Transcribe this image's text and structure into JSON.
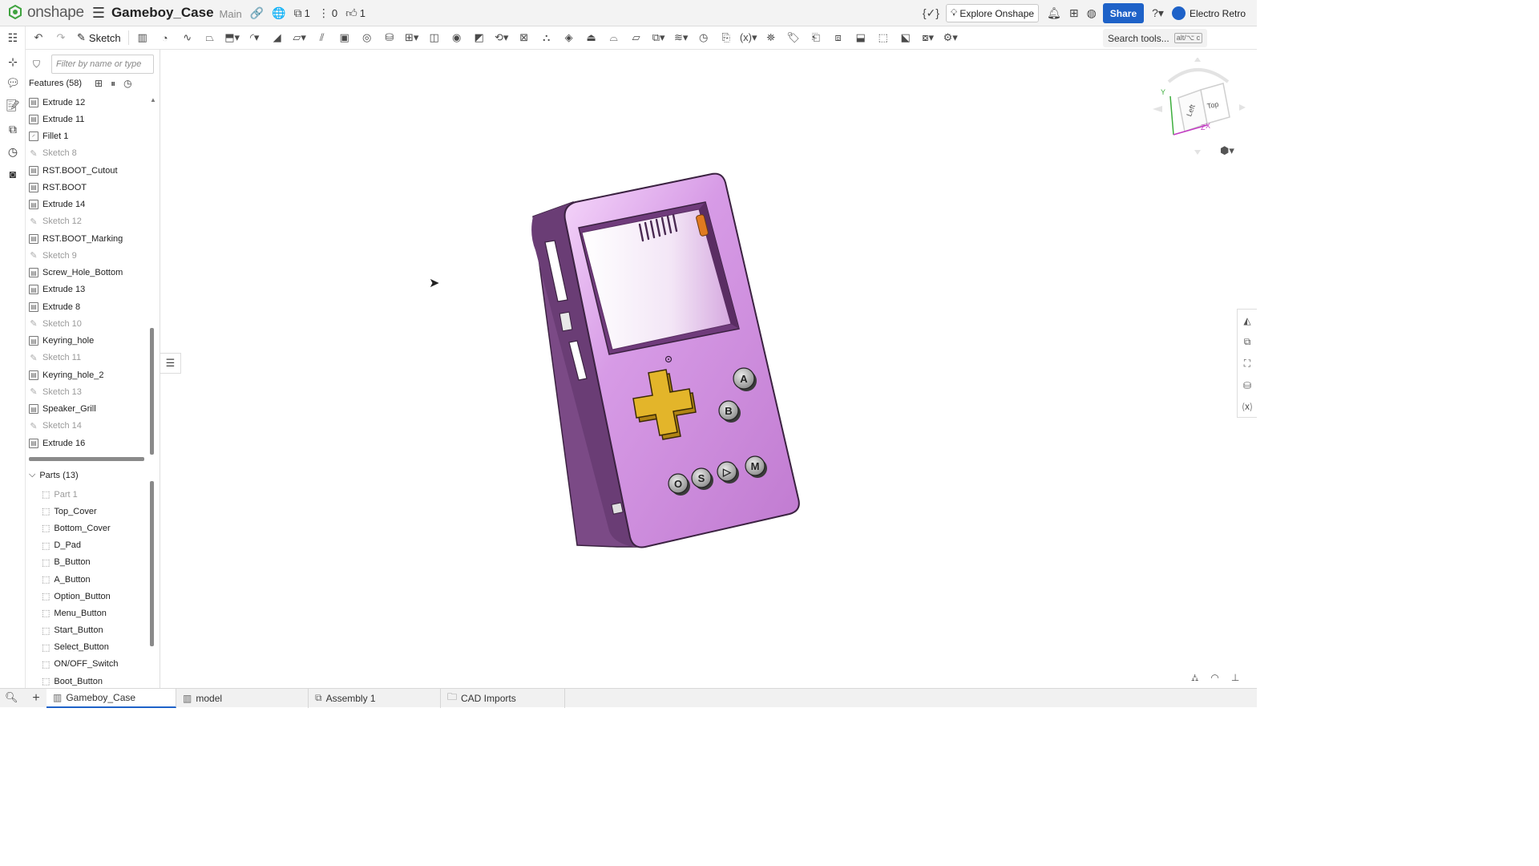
{
  "app": {
    "brand": "onshape",
    "doc_title": "Gameboy_Case",
    "branch": "Main",
    "versions_count": "1",
    "branches_count": "0",
    "likes_count": "1",
    "explore_label": "Explore Onshape",
    "share_label": "Share",
    "user_name": "Electro Retro",
    "brand_color": "#3fa33f",
    "accent_color": "#1e62c8"
  },
  "toolbar": {
    "sketch_label": "Sketch",
    "search_label": "Search tools...",
    "search_shortcut": "alt/⌥ c"
  },
  "feature_panel": {
    "filter_placeholder": "Filter by name or type",
    "features_label": "Features (58)",
    "features": [
      {
        "name": "Extrude 12",
        "kind": "extrude"
      },
      {
        "name": "Extrude 11",
        "kind": "extrude"
      },
      {
        "name": "Fillet 1",
        "kind": "fillet"
      },
      {
        "name": "Sketch 8",
        "kind": "sketch"
      },
      {
        "name": "RST.BOOT_Cutout",
        "kind": "extrude"
      },
      {
        "name": "RST.BOOT",
        "kind": "extrude"
      },
      {
        "name": "Extrude 14",
        "kind": "extrude"
      },
      {
        "name": "Sketch 12",
        "kind": "sketch"
      },
      {
        "name": "RST.BOOT_Marking",
        "kind": "extrude"
      },
      {
        "name": "Sketch 9",
        "kind": "sketch"
      },
      {
        "name": "Screw_Hole_Bottom",
        "kind": "extrude"
      },
      {
        "name": "Extrude 13",
        "kind": "extrude"
      },
      {
        "name": "Extrude 8",
        "kind": "extrude"
      },
      {
        "name": "Sketch 10",
        "kind": "sketch"
      },
      {
        "name": "Keyring_hole",
        "kind": "extrude"
      },
      {
        "name": "Sketch 11",
        "kind": "sketch"
      },
      {
        "name": "Keyring_hole_2",
        "kind": "extrude"
      },
      {
        "name": "Sketch 13",
        "kind": "sketch"
      },
      {
        "name": "Speaker_Grill",
        "kind": "extrude"
      },
      {
        "name": "Sketch 14",
        "kind": "sketch"
      },
      {
        "name": "Extrude 16",
        "kind": "extrude"
      }
    ],
    "parts_label": "Parts (13)",
    "parts": [
      {
        "name": "Part 1",
        "dim": true
      },
      {
        "name": "Top_Cover",
        "dim": false
      },
      {
        "name": "Bottom_Cover",
        "dim": false
      },
      {
        "name": "D_Pad",
        "dim": false
      },
      {
        "name": "B_Button",
        "dim": false
      },
      {
        "name": "A_Button",
        "dim": false
      },
      {
        "name": "Option_Button",
        "dim": false
      },
      {
        "name": "Menu_Button",
        "dim": false
      },
      {
        "name": "Start_Button",
        "dim": false
      },
      {
        "name": "Select_Button",
        "dim": false
      },
      {
        "name": "ON/OFF_Switch",
        "dim": false
      },
      {
        "name": "Boot_Button",
        "dim": false
      }
    ]
  },
  "viewcube": {
    "left": "Left",
    "top": "Top",
    "axis_x": "X",
    "axis_y": "Y",
    "axis_z": "Z"
  },
  "model": {
    "case_color": "#c58ad6",
    "dpad_color": "#e3b52a",
    "button_labels": [
      "A",
      "B",
      "O",
      "S",
      "▷",
      "M"
    ]
  },
  "tabs": [
    {
      "label": "Gameboy_Case",
      "active": true
    },
    {
      "label": "model",
      "active": false
    },
    {
      "label": "Assembly 1",
      "active": false
    },
    {
      "label": "CAD Imports",
      "active": false
    }
  ]
}
